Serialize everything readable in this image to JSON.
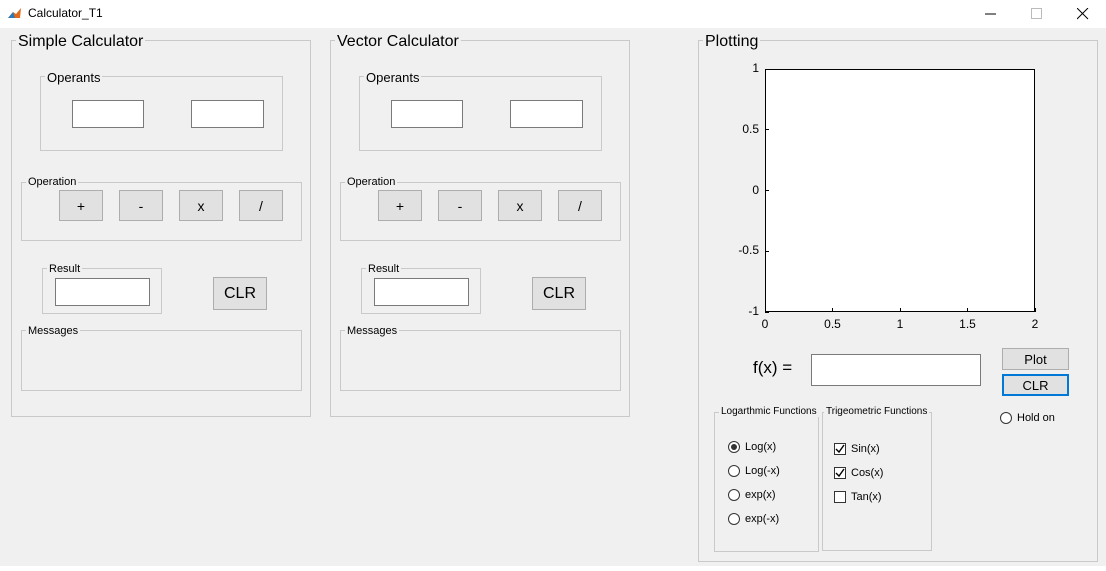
{
  "window": {
    "title": "Calculator_T1"
  },
  "simple": {
    "title": "Simple Calculator",
    "operands_label": "Operants",
    "operation_label": "Operation",
    "ops": [
      "+",
      "-",
      "x",
      "/"
    ],
    "result_label": "Result",
    "clear_label": "CLR",
    "messages_label": "Messages"
  },
  "vector": {
    "title": "Vector Calculator",
    "operands_label": "Operants",
    "operation_label": "Operation",
    "ops": [
      "+",
      "-",
      "x",
      "/"
    ],
    "result_label": "Result",
    "clear_label": "CLR",
    "messages_label": "Messages"
  },
  "plotting": {
    "title": "Plotting",
    "fx_label": "f(x) =",
    "plot_label": "Plot",
    "clear_label": "CLR",
    "hold_label": "Hold on",
    "log_title": "Logarthmic Functions",
    "log_options": [
      "Log(x)",
      "Log(-x)",
      "exp(x)",
      "exp(-x)"
    ],
    "trig_title": "Trigeometric Functions",
    "trig_options": [
      "Sin(x)",
      "Cos(x)",
      "Tan(x)"
    ]
  },
  "chart_data": {
    "type": "line",
    "series": [],
    "xlim": [
      0,
      2
    ],
    "ylim": [
      -1,
      1
    ],
    "xticks": [
      "0",
      "0.5",
      "1",
      "1.5",
      "2"
    ],
    "yticks": [
      "1",
      "0.5",
      "0",
      "-0.5",
      "-1"
    ],
    "grid": false
  },
  "states": {
    "log_selected": 0,
    "trig_checked": [
      true,
      true,
      false
    ],
    "hold_on": false
  }
}
